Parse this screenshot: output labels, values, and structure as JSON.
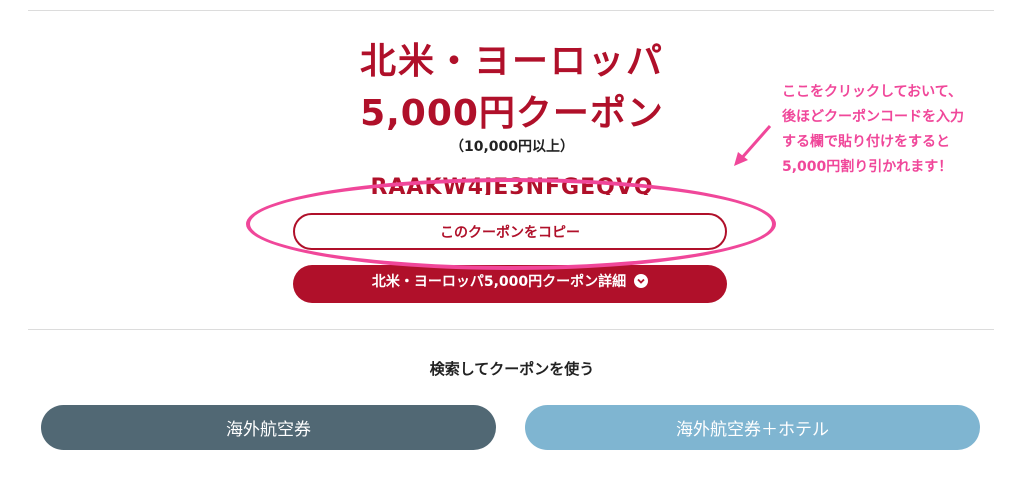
{
  "coupon": {
    "title_line1": "北米・ヨーロッパ",
    "title_line2": "5,000円クーポン",
    "condition": "（10,000円以上）",
    "code": "RAAKW4JE3NFGEQVQ",
    "copy_button_label": "このクーポンをコピー",
    "details_button_label": "北米・ヨーロッパ5,000円クーポン詳細"
  },
  "annotation": {
    "line1": "ここをクリックしておいて、",
    "line2": "後ほどクーポンコードを入力",
    "line3": "する欄で貼り付けをすると",
    "line4": "5,000円割り引かれます！"
  },
  "search": {
    "title": "検索してクーポンを使う",
    "buttons": [
      {
        "label": "海外航空券"
      },
      {
        "label": "海外航空券＋ホテル"
      }
    ]
  },
  "colors": {
    "brand_red": "#b0102a",
    "annotation_pink": "#f0479a",
    "flight_button": "#516874",
    "flight_hotel_button": "#7fb5d1"
  },
  "icons": {
    "details_chevron": "chevron-down-circle-icon",
    "annotation_arrow": "arrow-icon"
  }
}
